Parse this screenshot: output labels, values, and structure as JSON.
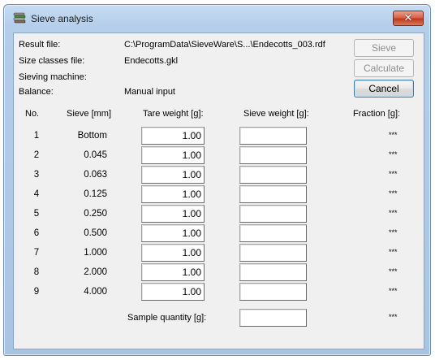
{
  "window": {
    "title": "Sieve analysis"
  },
  "info": [
    {
      "label": "Result file:",
      "value": "C:\\ProgramData\\SieveWare\\S...\\Endecotts_003.rdf"
    },
    {
      "label": "Size classes file:",
      "value": "Endecotts.gkl"
    },
    {
      "label": "Sieving machine:",
      "value": ""
    },
    {
      "label": "Balance:",
      "value": "Manual input"
    }
  ],
  "buttons": {
    "sieve": "Sieve",
    "calculate": "Calculate",
    "cancel": "Cancel"
  },
  "headers": {
    "no": "No.",
    "sieve": "Sieve [mm]",
    "tare": "Tare weight [g]:",
    "sieve_weight": "Sieve weight [g]:",
    "fraction": "Fraction [g]:"
  },
  "rows": [
    {
      "no": "1",
      "sieve": "Bottom",
      "tare": "1.00",
      "sieve_weight": "",
      "fraction": "***"
    },
    {
      "no": "2",
      "sieve": "0.045",
      "tare": "1.00",
      "sieve_weight": "",
      "fraction": "***"
    },
    {
      "no": "3",
      "sieve": "0.063",
      "tare": "1.00",
      "sieve_weight": "",
      "fraction": "***"
    },
    {
      "no": "4",
      "sieve": "0.125",
      "tare": "1.00",
      "sieve_weight": "",
      "fraction": "***"
    },
    {
      "no": "5",
      "sieve": "0.250",
      "tare": "1.00",
      "sieve_weight": "",
      "fraction": "***"
    },
    {
      "no": "6",
      "sieve": "0.500",
      "tare": "1.00",
      "sieve_weight": "",
      "fraction": "***"
    },
    {
      "no": "7",
      "sieve": "1.000",
      "tare": "1.00",
      "sieve_weight": "",
      "fraction": "***"
    },
    {
      "no": "8",
      "sieve": "2.000",
      "tare": "1.00",
      "sieve_weight": "",
      "fraction": "***"
    },
    {
      "no": "9",
      "sieve": "4.000",
      "tare": "1.00",
      "sieve_weight": "",
      "fraction": "***"
    }
  ],
  "sample": {
    "label": "Sample quantity [g]:",
    "value": "",
    "fraction": "***"
  },
  "icons": {
    "app": "sieve-stack-icon",
    "close": "close-icon"
  }
}
